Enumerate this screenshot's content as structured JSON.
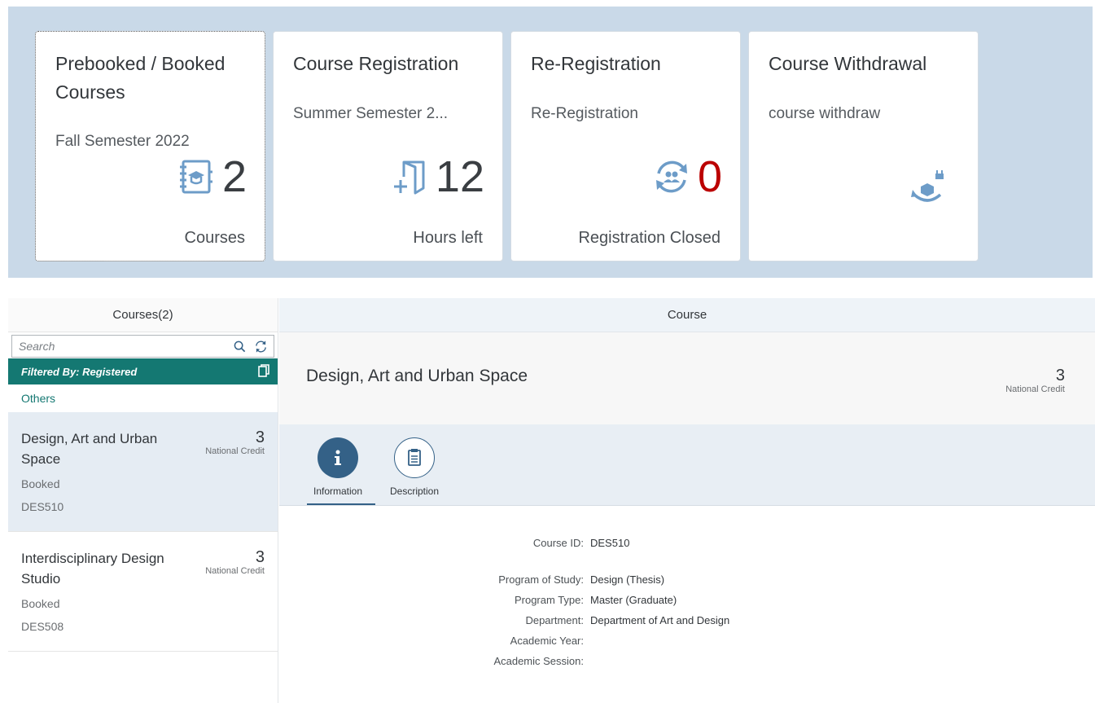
{
  "tiles": [
    {
      "title": "Prebooked / Booked Courses",
      "subtitle": "Fall Semester 2022",
      "number": "2",
      "footer": "Courses",
      "icon": "course-book-icon"
    },
    {
      "title": "Course Registration",
      "subtitle": "Summer Semester 2...",
      "number": "12",
      "footer": "Hours left",
      "icon": "add-document-icon"
    },
    {
      "title": "Re-Registration",
      "subtitle": "Re-Registration",
      "number": "0",
      "footer": "Registration Closed",
      "icon": "re-registration-icon"
    },
    {
      "title": "Course Withdrawal",
      "subtitle": "course withdraw",
      "number": "",
      "footer": "",
      "icon": "withdraw-icon"
    }
  ],
  "master": {
    "title": "Courses(2)",
    "search_placeholder": "Search",
    "filter_label": "Filtered By: Registered",
    "others_label": "Others",
    "items": [
      {
        "title": "Design, Art and Urban Space",
        "number": "3",
        "unit": "National Credit",
        "status": "Booked",
        "code": "DES510"
      },
      {
        "title": "Interdisciplinary Design Studio",
        "number": "3",
        "unit": "National Credit",
        "status": "Booked",
        "code": "DES508"
      }
    ]
  },
  "detail": {
    "title": "Course",
    "object_title": "Design, Art and Urban Space",
    "object_number": "3",
    "object_unit": "National Credit",
    "tabs": [
      {
        "label": "Information",
        "icon": "info-icon"
      },
      {
        "label": "Description",
        "icon": "document-text-icon"
      }
    ],
    "fields": [
      {
        "label": "Course ID:",
        "value": "DES510"
      },
      {
        "label": "Program of Study:",
        "value": "Design (Thesis)"
      },
      {
        "label": "Program Type:",
        "value": "Master (Graduate)"
      },
      {
        "label": "Department:",
        "value": "Department of Art and Design"
      },
      {
        "label": "Academic Year:",
        "value": ""
      },
      {
        "label": "Academic Session:",
        "value": ""
      }
    ]
  },
  "colors": {
    "tile_bg_area": "#c9d9e8",
    "accent_teal": "#147872",
    "accent_blue": "#346187",
    "negative_red": "#bb0000",
    "icon_blue": "#6d9cc8"
  }
}
